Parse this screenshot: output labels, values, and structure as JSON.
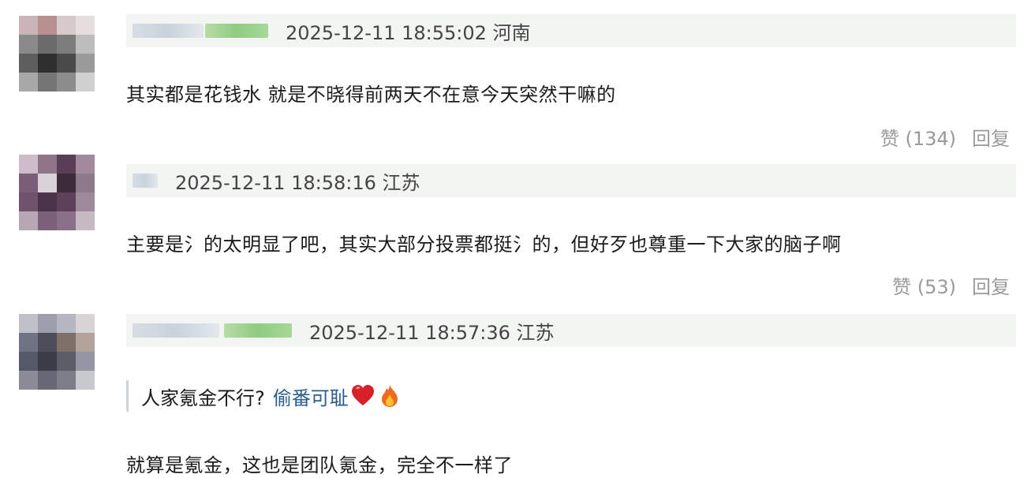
{
  "comments": [
    {
      "timestamp_location": "2025-12-11 18:55:02 河南",
      "text": "其实都是花钱水 就是不晓得前两天不在意今天突然干嘛的",
      "like_label": "赞 (134)",
      "reply_label": "回复"
    },
    {
      "timestamp_location": "2025-12-11 18:58:16 江苏",
      "text": "主要是氵的太明显了吧，其实大部分投票都挺氵的，但好歹也尊重一下大家的脑子啊",
      "like_label": "赞 (53)",
      "reply_label": "回复"
    },
    {
      "timestamp_location": "2025-12-11 18:57:36 江苏",
      "quote_text": "人家氪金不行?",
      "quote_highlight": "偷番可耻",
      "text": "就算是氪金，这也是团队氪金，完全不一样了"
    }
  ],
  "colors": {
    "meta_bar": "#f3f5f3",
    "quote_link": "#2c5d8f",
    "action_gray": "#9a9a9a"
  },
  "icons": [
    "heart-emoji-icon",
    "fire-emoji-icon"
  ]
}
